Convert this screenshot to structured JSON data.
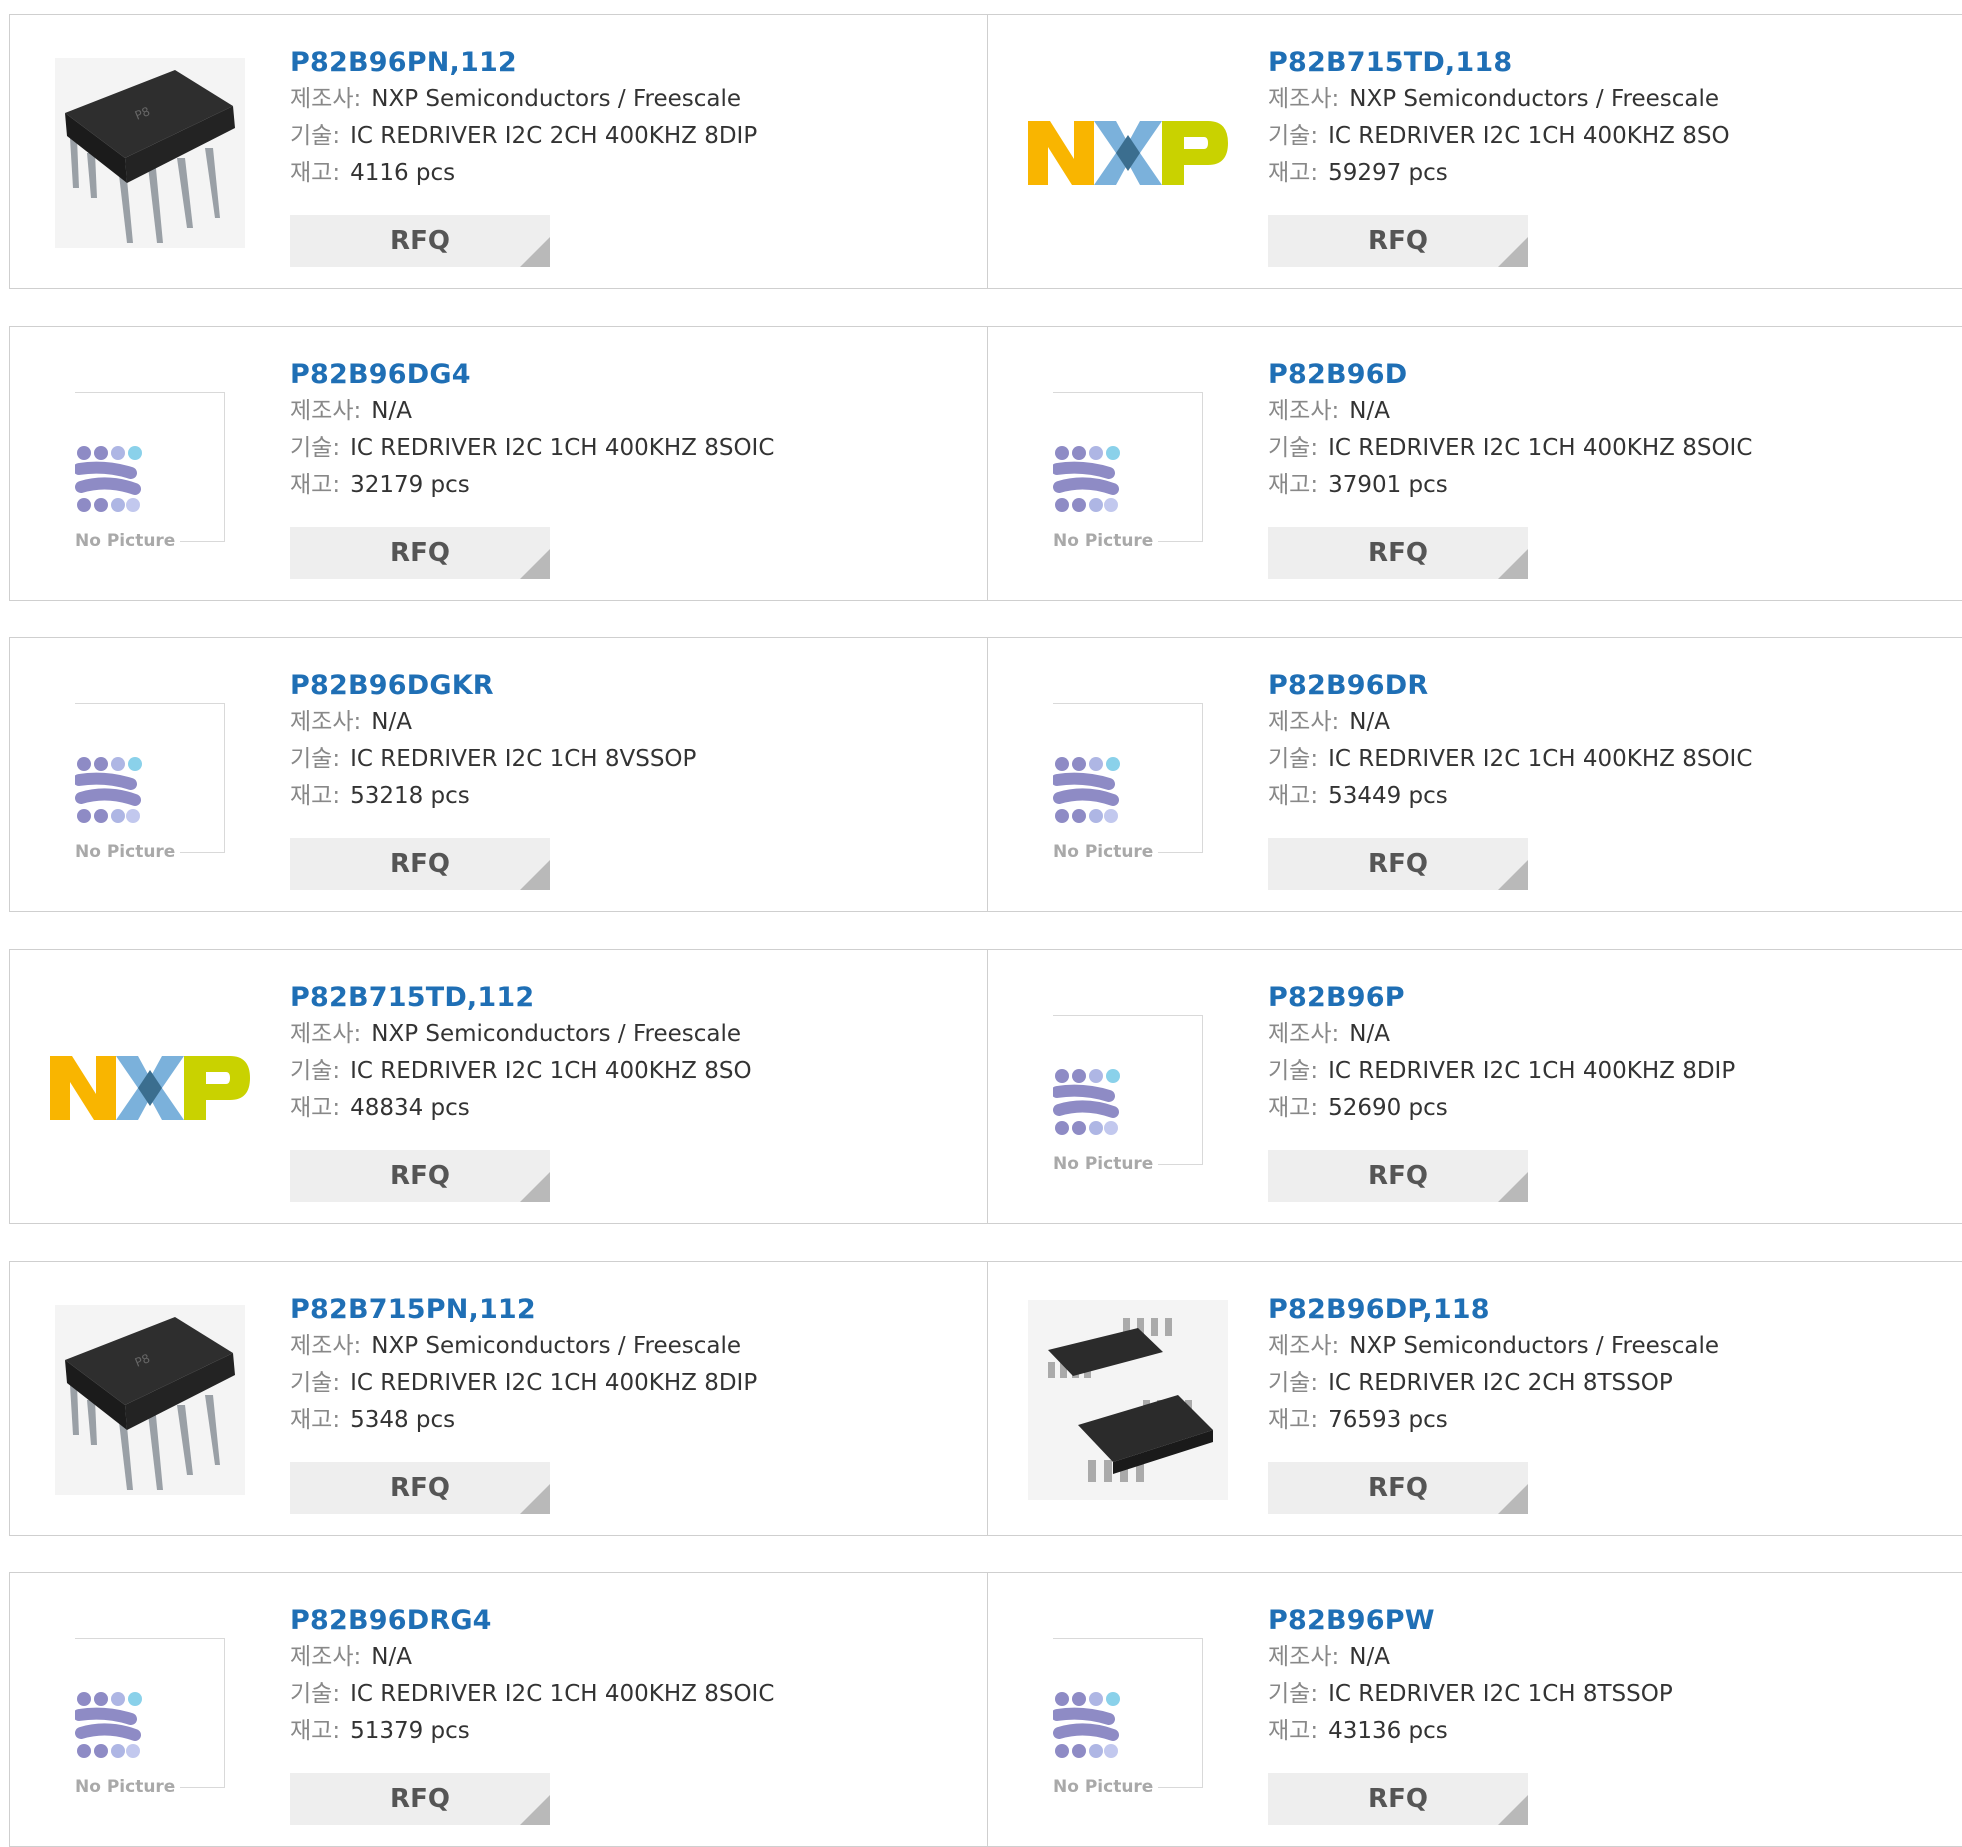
{
  "labels": {
    "manufacturer": "제조사",
    "description": "기술",
    "stock": "재고",
    "separator": ":",
    "rfq": "RFQ",
    "no_picture": "No Picture",
    "nxp_logo_text": "NXP"
  },
  "colors": {
    "part_link": "#1f6fb5",
    "rfq_bg": "#eeeeee",
    "rfq_corner": "#b9b9b9",
    "nxp_orange": "#f9b500",
    "nxp_blue": "#7bb1db",
    "nxp_green": "#c9d200"
  },
  "products": [
    {
      "part": "P82B96PN,112",
      "manufacturer": "NXP Semiconductors / Freescale",
      "description": "IC REDRIVER I2C 2CH 400KHZ 8DIP",
      "stock": "4116 pcs",
      "image": "dip8-chip-icon"
    },
    {
      "part": "P82B715TD,118",
      "manufacturer": "NXP Semiconductors / Freescale",
      "description": "IC REDRIVER I2C 1CH 400KHZ 8SO",
      "stock": "59297 pcs",
      "image": "nxp-logo-icon"
    },
    {
      "part": "P82B96DG4",
      "manufacturer": "N/A",
      "description": "IC REDRIVER I2C 1CH 400KHZ 8SOIC",
      "stock": "32179 pcs",
      "image": "no-picture-icon"
    },
    {
      "part": "P82B96D",
      "manufacturer": "N/A",
      "description": "IC REDRIVER I2C 1CH 400KHZ 8SOIC",
      "stock": "37901 pcs",
      "image": "no-picture-icon"
    },
    {
      "part": "P82B96DGKR",
      "manufacturer": "N/A",
      "description": "IC REDRIVER I2C 1CH 8VSSOP",
      "stock": "53218 pcs",
      "image": "no-picture-icon"
    },
    {
      "part": "P82B96DR",
      "manufacturer": "N/A",
      "description": "IC REDRIVER I2C 1CH 400KHZ 8SOIC",
      "stock": "53449 pcs",
      "image": "no-picture-icon"
    },
    {
      "part": "P82B715TD,112",
      "manufacturer": "NXP Semiconductors / Freescale",
      "description": "IC REDRIVER I2C 1CH 400KHZ 8SO",
      "stock": "48834 pcs",
      "image": "nxp-logo-icon"
    },
    {
      "part": "P82B96P",
      "manufacturer": "N/A",
      "description": "IC REDRIVER I2C 1CH 400KHZ 8DIP",
      "stock": "52690 pcs",
      "image": "no-picture-icon"
    },
    {
      "part": "P82B715PN,112",
      "manufacturer": "NXP Semiconductors / Freescale",
      "description": "IC REDRIVER I2C 1CH 400KHZ 8DIP",
      "stock": "5348 pcs",
      "image": "dip8-chip-icon"
    },
    {
      "part": "P82B96DP,118",
      "manufacturer": "NXP Semiconductors / Freescale",
      "description": "IC REDRIVER I2C 2CH 8TSSOP",
      "stock": "76593 pcs",
      "image": "tssop-chip-icon"
    },
    {
      "part": "P82B96DRG4",
      "manufacturer": "N/A",
      "description": "IC REDRIVER I2C 1CH 400KHZ 8SOIC",
      "stock": "51379 pcs",
      "image": "no-picture-icon"
    },
    {
      "part": "P82B96PW",
      "manufacturer": "N/A",
      "description": "IC REDRIVER I2C 1CH 8TSSOP",
      "stock": "43136 pcs",
      "image": "no-picture-icon"
    }
  ]
}
